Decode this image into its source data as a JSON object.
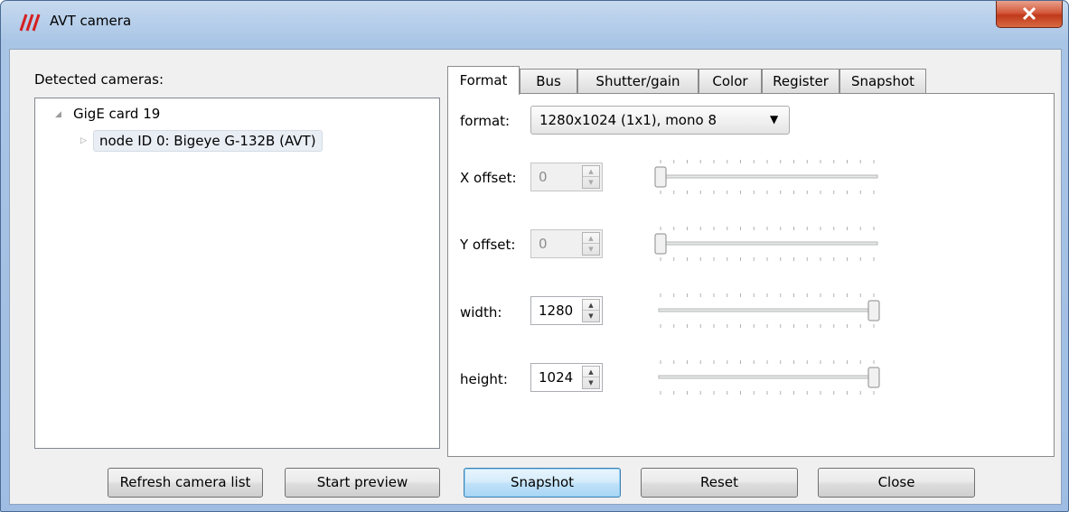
{
  "window": {
    "title": "AVT camera"
  },
  "left_panel": {
    "label": "Detected cameras:",
    "tree": {
      "root": "GigE card 19",
      "child": "node ID 0: Bigeye G-132B (AVT)"
    }
  },
  "tabs": [
    {
      "label": "Format"
    },
    {
      "label": "Bus"
    },
    {
      "label": "Shutter/gain"
    },
    {
      "label": "Color"
    },
    {
      "label": "Register"
    },
    {
      "label": "Snapshot"
    }
  ],
  "format_tab": {
    "format_label": "format:",
    "format_value": "1280x1024 (1x1), mono 8",
    "x_offset": {
      "label": "X offset:",
      "value": "0",
      "enabled": false,
      "slider_fraction": 0.0
    },
    "y_offset": {
      "label": "Y offset:",
      "value": "0",
      "enabled": false,
      "slider_fraction": 0.0
    },
    "width": {
      "label": "width:",
      "value": "1280",
      "enabled": true,
      "slider_fraction": 1.0
    },
    "height": {
      "label": "height:",
      "value": "1024",
      "enabled": true,
      "slider_fraction": 1.0
    }
  },
  "buttons": {
    "refresh": "Refresh camera list",
    "start_preview": "Start preview",
    "snapshot": "Snapshot",
    "reset": "Reset",
    "close": "Close"
  },
  "colors": {
    "title_gradient": "#a9c5e6",
    "close_button": "#c0391a",
    "default_button": "#bfe1f8",
    "app_icon": "#d42020"
  }
}
